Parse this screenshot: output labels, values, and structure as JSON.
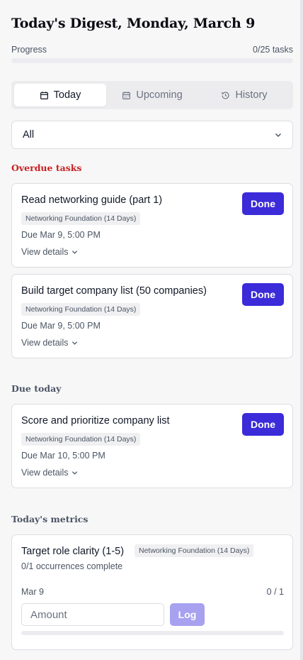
{
  "header": {
    "title": "Today's Digest, Monday, March 9",
    "progress_label": "Progress",
    "progress_count": "0/25 tasks",
    "progress_fraction": 0
  },
  "tabs": [
    {
      "label": "Today",
      "icon": "calendar-icon",
      "active": true
    },
    {
      "label": "Upcoming",
      "icon": "calendar-grid-icon",
      "active": false
    },
    {
      "label": "History",
      "icon": "history-icon",
      "active": false
    }
  ],
  "filter": {
    "selected": "All"
  },
  "sections": {
    "overdue": "Overdue tasks",
    "due_today": "Due today",
    "metrics": "Today's metrics"
  },
  "overdue_tasks": [
    {
      "title": "Read networking guide (part 1)",
      "program": "Networking Foundation (14 Days)",
      "due": "Due Mar 9, 5:00 PM",
      "details": "View details",
      "action": "Done"
    },
    {
      "title": "Build target company list (50 companies)",
      "program": "Networking Foundation (14 Days)",
      "due": "Due Mar 9, 5:00 PM",
      "details": "View details",
      "action": "Done"
    }
  ],
  "today_tasks": [
    {
      "title": "Score and prioritize company list",
      "program": "Networking Foundation (14 Days)",
      "due": "Due Mar 10, 5:00 PM",
      "details": "View details",
      "action": "Done"
    }
  ],
  "metric": {
    "title": "Target role clarity (1-5)",
    "program": "Networking Foundation (14 Days)",
    "occurrences": "0/1 occurrences complete",
    "date": "Mar 9",
    "count": "0 / 1",
    "input_placeholder": "Amount",
    "input_value": "",
    "log_label": "Log",
    "progress_fraction": 0
  },
  "colors": {
    "accent": "#3b2bd9",
    "accent_disabled": "#a7a1ef",
    "overdue": "#c81e1e"
  }
}
